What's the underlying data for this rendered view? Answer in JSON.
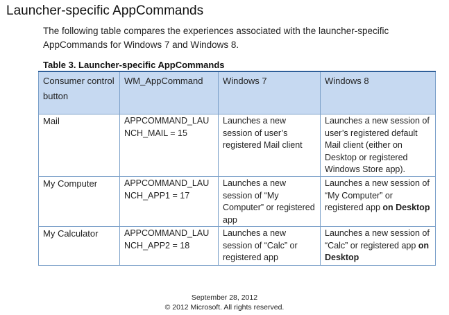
{
  "heading": "Launcher-specific AppCommands",
  "intro": "The following table compares the experiences associated with the launcher-specific AppCommands for Windows 7 and Windows 8.",
  "table": {
    "caption": "Table 3. Launcher-specific AppCommands",
    "headers": [
      "Consumer control button",
      "WM_AppCommand",
      "Windows 7",
      "Windows 8"
    ],
    "rows": [
      {
        "button": "Mail",
        "command": "APPCOMMAND_LAUNCH_MAIL = 15",
        "win7": "Launches a new session of user’s registered Mail client",
        "win8": "Launches a new session of user’s registered default Mail client (either on Desktop or registered Windows Store app)."
      },
      {
        "button": "My Computer",
        "command": "APPCOMMAND_LAUNCH_APP1 = 17",
        "win7": "Launches a new session of “My Computer” or registered app",
        "win8_text": "Launches a new session of “My Computer” or registered app ",
        "win8_bold": "on Desktop"
      },
      {
        "button": "My Calculator",
        "command": "APPCOMMAND_LAUNCH_APP2 = 18",
        "win7": "Launches a new session of “Calc” or registered app",
        "win8_text": "Launches a new session of “Calc” or registered app ",
        "win8_bold": "on Desktop"
      }
    ]
  },
  "footer": {
    "date": "September 28, 2012",
    "copyright": "© 2012 Microsoft. All rights reserved."
  }
}
